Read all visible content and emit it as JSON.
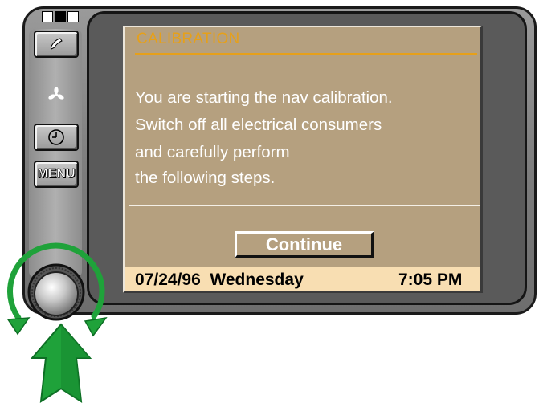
{
  "screen": {
    "title": "CALIBRATION",
    "message_lines": [
      "You are starting the nav calibration.",
      "Switch off all electrical consumers",
      "and carefully perform",
      "the following steps."
    ],
    "continue_label": "Continue"
  },
  "status_bar": {
    "date": "07/24/96",
    "day": "Wednesday",
    "time": "7:05 PM"
  },
  "side_buttons": {
    "phone_icon": "phone-icon",
    "fan_icon": "fan-icon",
    "clock_icon": "clock-icon",
    "menu_label": "MENU"
  },
  "controller": {
    "knob": "rotary-knob",
    "rotate_arrows": "rotate-arrows-icon",
    "press_arrow": "press-arrow-icon"
  },
  "colors": {
    "screen_bg": "#b5a07f",
    "title_color": "#e6a01a",
    "status_bar_bg": "#f8deb2",
    "arrow_green": "#1fa23a"
  }
}
